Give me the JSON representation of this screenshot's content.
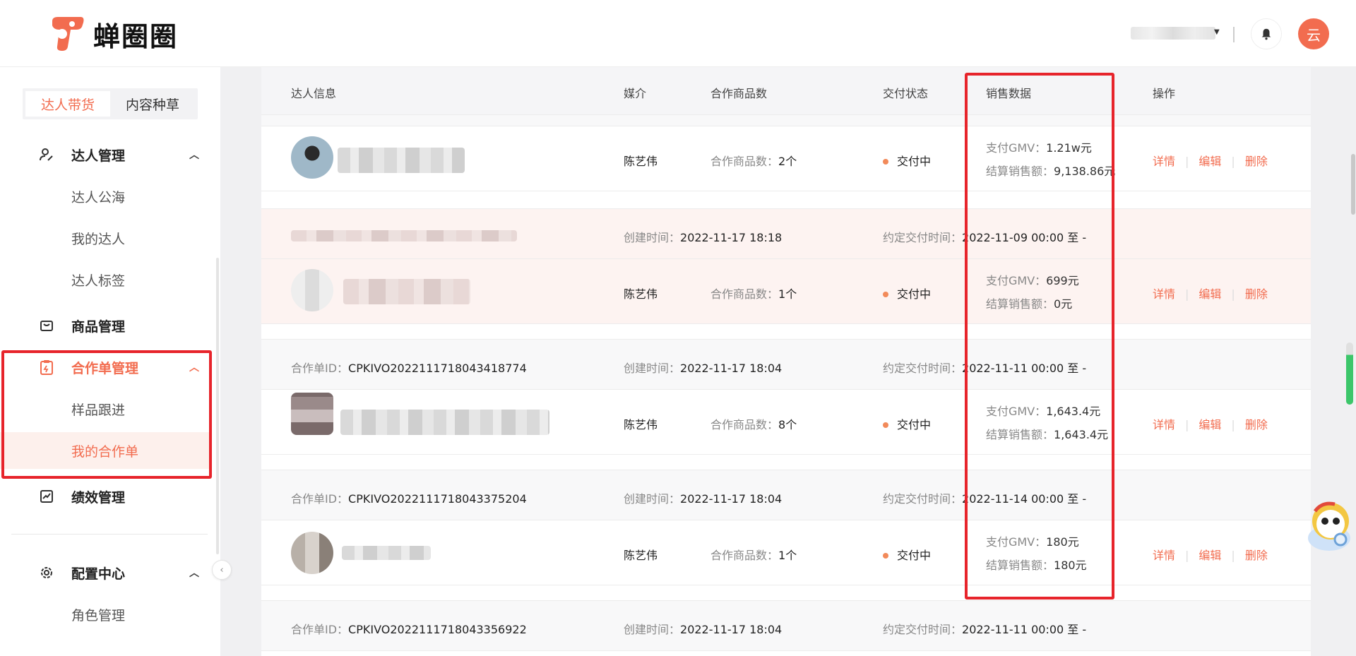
{
  "app": {
    "brand": "蝉圈圈",
    "avatar_letter": "云"
  },
  "sidebar": {
    "tabs": [
      {
        "label": "达人带货",
        "active": true
      },
      {
        "label": "内容种草",
        "active": false
      }
    ],
    "groups": {
      "talent": {
        "label": "达人管理",
        "icon": "user-edit-icon",
        "items": [
          "达人公海",
          "我的达人",
          "达人标签"
        ]
      },
      "product": {
        "label": "商品管理",
        "icon": "bag-icon"
      },
      "cooperation": {
        "label": "合作单管理",
        "icon": "clipboard-icon",
        "items": [
          "样品跟进",
          "我的合作单"
        ],
        "active_item": "我的合作单"
      },
      "performance": {
        "label": "绩效管理",
        "icon": "chart-up-icon"
      },
      "config": {
        "label": "配置中心",
        "icon": "gear-icon",
        "items": [
          "角色管理"
        ]
      }
    }
  },
  "table": {
    "headers": {
      "talent": "达人信息",
      "media": "媒介",
      "goods_count": "合作商品数",
      "delivery": "交付状态",
      "sales": "销售数据",
      "ops": "操作"
    },
    "labels": {
      "order_id": "合作单ID：",
      "created": "创建时间：",
      "deadline": "约定交付时间：",
      "goods_count": "合作商品数：",
      "gmv": "支付GMV：",
      "settled": "结算销售额："
    },
    "ops": {
      "detail": "详情",
      "edit": "编辑",
      "delete": "删除"
    },
    "rows": [
      {
        "order_id": "",
        "created": "",
        "deadline": "",
        "media": "陈艺伟",
        "goods_count": "2个",
        "status": "交付中",
        "gmv": "1.21w元",
        "settled": "9,138.86元"
      },
      {
        "order_id": "",
        "created": "2022-11-17 18:18",
        "deadline": "2022-11-09 00:00  至   -",
        "media": "陈艺伟",
        "goods_count": "1个",
        "status": "交付中",
        "gmv": "699元",
        "settled": "0元"
      },
      {
        "order_id": "CPKIVO2022111718043418774",
        "created": "2022-11-17 18:04",
        "deadline": "2022-11-11 00:00  至   -",
        "media": "陈艺伟",
        "goods_count": "8个",
        "status": "交付中",
        "gmv": "1,643.4元",
        "settled": "1,643.4元"
      },
      {
        "order_id": "CPKIVO2022111718043375204",
        "created": "2022-11-17 18:04",
        "deadline": "2022-11-14 00:00  至   -",
        "media": "陈艺伟",
        "goods_count": "1个",
        "status": "交付中",
        "gmv": "180元",
        "settled": "180元"
      },
      {
        "order_id": "CPKIVO2022111718043356922",
        "created": "2022-11-17 18:04",
        "deadline": "2022-11-11 00:00  至   -"
      }
    ]
  },
  "colors": {
    "accent": "#f26c4f",
    "highlight_box": "#e7242b",
    "status_dot": "#f28a5a"
  }
}
